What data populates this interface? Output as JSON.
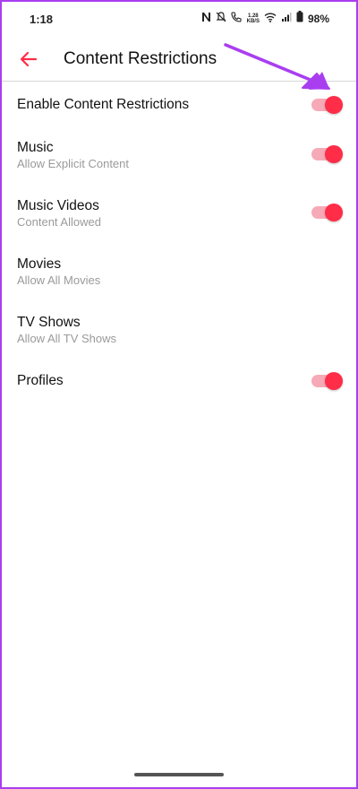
{
  "status_bar": {
    "time": "1:18",
    "speed_value": "1.28",
    "speed_unit": "KB/S",
    "battery": "98%"
  },
  "header": {
    "title": "Content Restrictions"
  },
  "rows": [
    {
      "title": "Enable Content Restrictions",
      "subtitle": "",
      "toggle": true,
      "on": true
    },
    {
      "title": "Music",
      "subtitle": "Allow Explicit Content",
      "toggle": true,
      "on": true
    },
    {
      "title": "Music Videos",
      "subtitle": "Content Allowed",
      "toggle": true,
      "on": true
    },
    {
      "title": "Movies",
      "subtitle": "Allow All Movies",
      "toggle": false
    },
    {
      "title": "TV Shows",
      "subtitle": "Allow All TV Shows",
      "toggle": false
    },
    {
      "title": "Profiles",
      "subtitle": "",
      "toggle": true,
      "on": true
    }
  ],
  "colors": {
    "accent": "#ff2d48",
    "toggle_track": "#f6aab7",
    "annotation": "#a93ef0",
    "subtitle": "#9a9a9a"
  },
  "icons": {
    "back": "arrow-left-icon",
    "nfc": "nfc-icon",
    "mute": "bell-off-icon",
    "call": "wifi-call-icon",
    "wifi": "wifi-icon",
    "signal": "signal-icon",
    "battery": "battery-icon"
  }
}
